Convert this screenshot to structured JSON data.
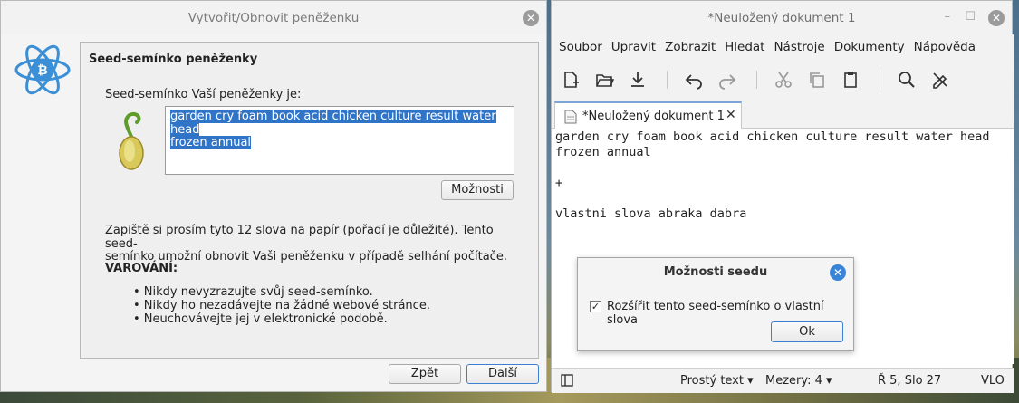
{
  "wizard": {
    "title": "Vytvořit/Obnovit peněženku",
    "close_glyph": "✕",
    "group_title": "Seed-semínko peněženky",
    "seed_label": "Seed-semínko Vaší peněženky je:",
    "seed_line1": "garden cry foam book acid chicken culture result water head",
    "seed_line2": "frozen annual",
    "options_button": "Možnosti",
    "instructions_line1": "Zapiště si prosím tyto 12 slova na papír (pořadí je důležité). Tento seed-",
    "instructions_line2": "semínko umožní obnovit Vaši peněženku v případě selhání počítače.",
    "warning_title": "VAROVÁNÍ:",
    "bullets": [
      "• Nikdy nevyzrazujte svůj seed-semínko.",
      "• Nikdy ho nezadávejte na žádné webové stránce.",
      "• Neuchovávejte jej v elektronické podobě."
    ],
    "back_button": "Zpět",
    "next_button": "Další"
  },
  "editor": {
    "title": "*Neuložený dokument 1",
    "menu": [
      "Soubor",
      "Upravit",
      "Zobrazit",
      "Hledat",
      "Nástroje",
      "Dokumenty",
      "Nápověda"
    ],
    "tab_label": "*Neuložený dokument 1",
    "tab_close": "✕",
    "lines": [
      "garden cry foam book acid chicken culture result water head",
      "frozen annual",
      "",
      "+",
      "",
      "vlastni slova abraka dabra"
    ],
    "status": {
      "language": "Prostý text",
      "spaces": "Mezery: 4",
      "position": "Ř 5, Slo 27",
      "mode": "VLO"
    },
    "toolbar_icons": [
      "new-document-icon",
      "open-folder-icon",
      "save-download-icon",
      "undo-icon",
      "redo-icon",
      "cut-icon",
      "copy-icon",
      "paste-icon",
      "search-icon",
      "spellcheck-icon"
    ]
  },
  "seed_options_dialog": {
    "title": "Možnosti seedu",
    "checkbox_label": "Rozšířit tento seed-semínko o vlastní slova",
    "checkbox_checked": true,
    "check_glyph": "✓",
    "ok_button": "Ok",
    "close_glyph": "✕"
  },
  "colors": {
    "selection": "#3074c8",
    "dialog_close": "#3a84d8",
    "electrum_blue": "#3a8fd6"
  }
}
